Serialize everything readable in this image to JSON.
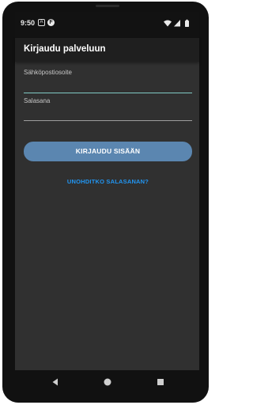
{
  "status_bar": {
    "time": "9:50",
    "notif_a": "A",
    "notif_f": "F"
  },
  "app_bar": {
    "title": "Kirjaudu palveluun"
  },
  "form": {
    "email_label": "Sähköpostiosoite",
    "email_value": "",
    "password_label": "Salasana",
    "password_value": "",
    "login_button": "KIRJAUDU SISÄÄN",
    "forgot_link": "UNOHDITKO SALASANAN?"
  },
  "colors": {
    "accent_field_line": "#80cbc4",
    "button_bg": "#5b86b0",
    "link": "#2196f3",
    "background": "#303030",
    "app_bar": "#1f1f1f"
  },
  "icons": {
    "status": [
      "notification-a-icon",
      "notification-f-icon",
      "wifi-icon",
      "signal-icon",
      "battery-icon"
    ],
    "navigation": [
      "back-icon",
      "home-icon",
      "recents-icon"
    ]
  }
}
